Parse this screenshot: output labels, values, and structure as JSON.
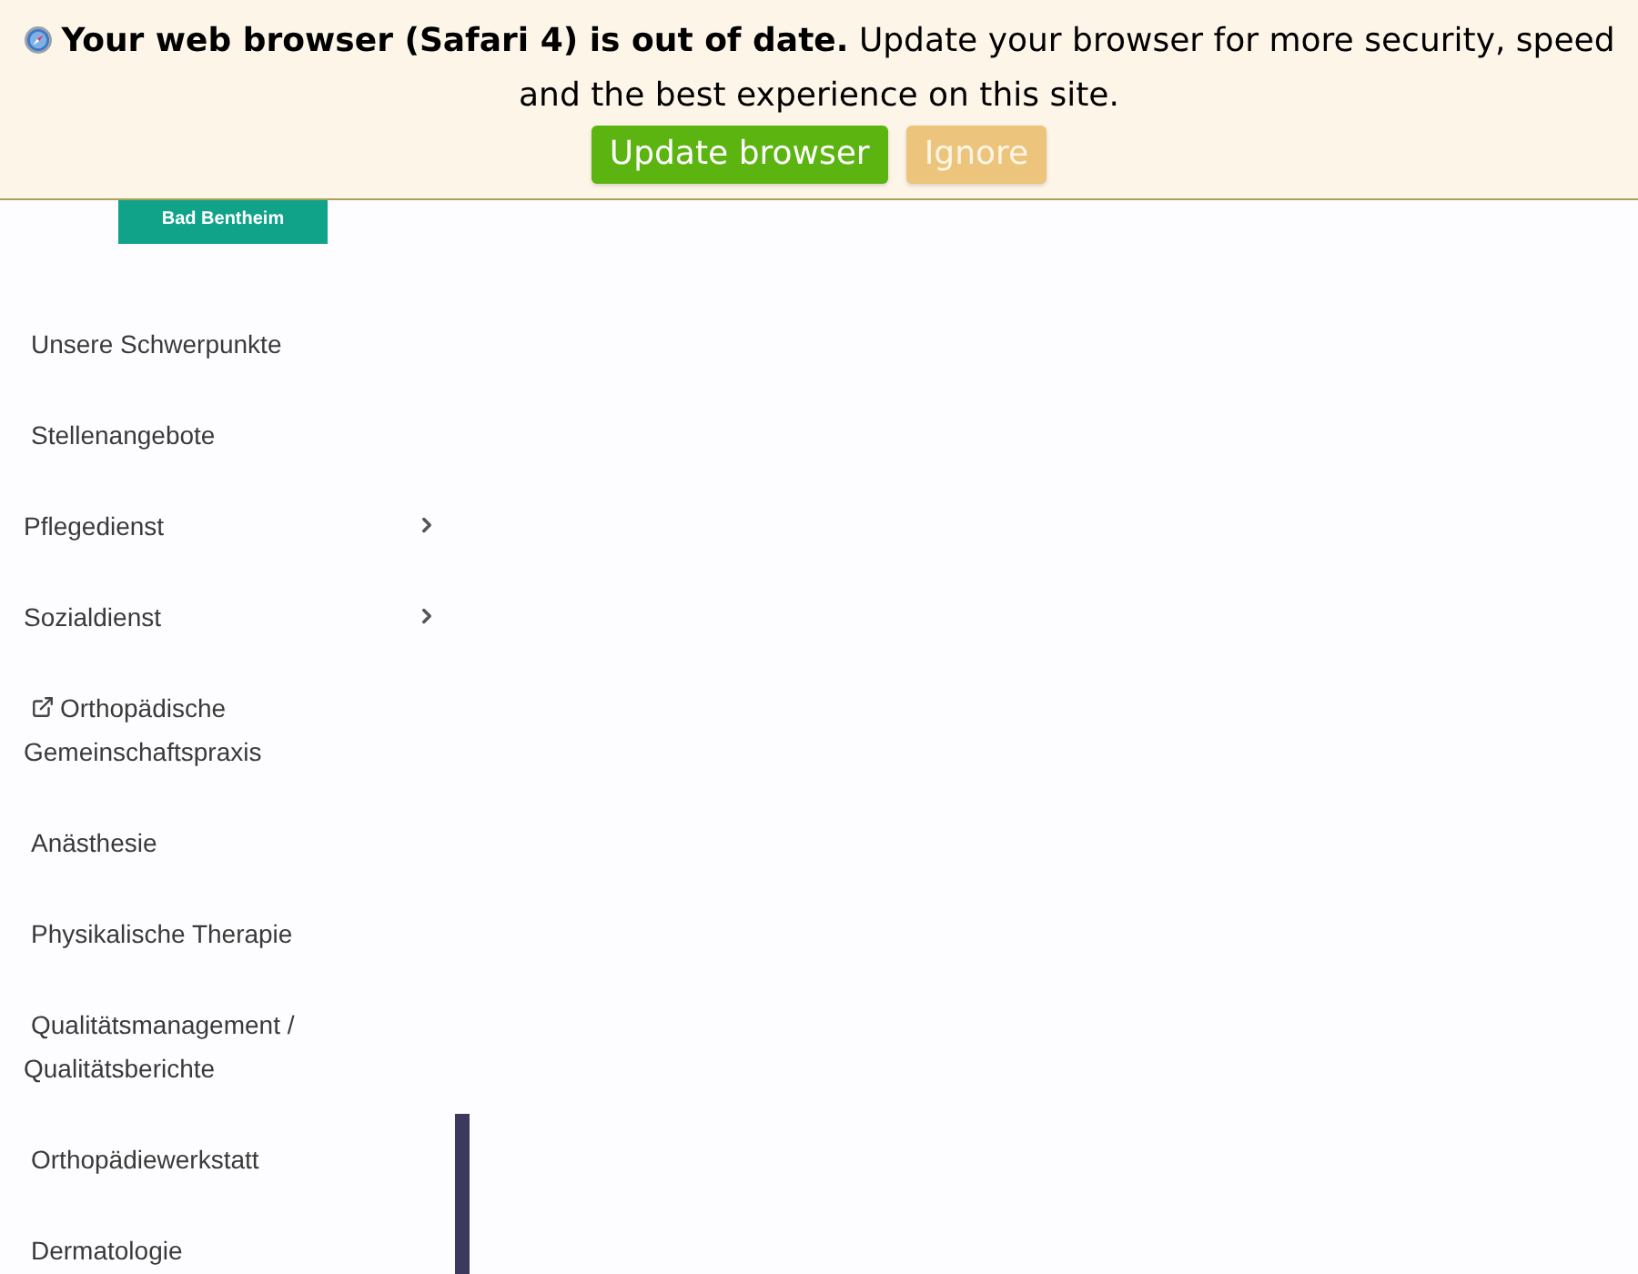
{
  "update_banner": {
    "message": "**Your web browser (Safari 4) is out of date.** Update your browser for more security, speed and the best experience on this site.",
    "buttons": [
      {
        "label": "Update browser",
        "kind": "primary"
      },
      {
        "label": "Ignore",
        "kind": "secondary"
      }
    ]
  },
  "logo": {
    "text": "Bad Bentheim"
  },
  "sidebar": {
    "items": [
      {
        "label": "Unsere Schwerpunkte",
        "kind": "link"
      },
      {
        "label": "Stellenangebote",
        "kind": "link"
      },
      {
        "label": "Pflegedienst",
        "kind": "submenu"
      },
      {
        "label": "Sozialdienst",
        "kind": "submenu"
      },
      {
        "label": "Orthopädische Gemeinschaftspraxis",
        "kind": "external"
      },
      {
        "label": "Anästhesie",
        "kind": "link"
      },
      {
        "label": "Physikalische Therapie",
        "kind": "link"
      },
      {
        "label": "Qualitätsmanagement / Qualitätsberichte",
        "kind": "link"
      },
      {
        "label": "Orthopädiewerkstatt",
        "kind": "link"
      },
      {
        "label": "Dermatologie",
        "kind": "link"
      }
    ]
  }
}
